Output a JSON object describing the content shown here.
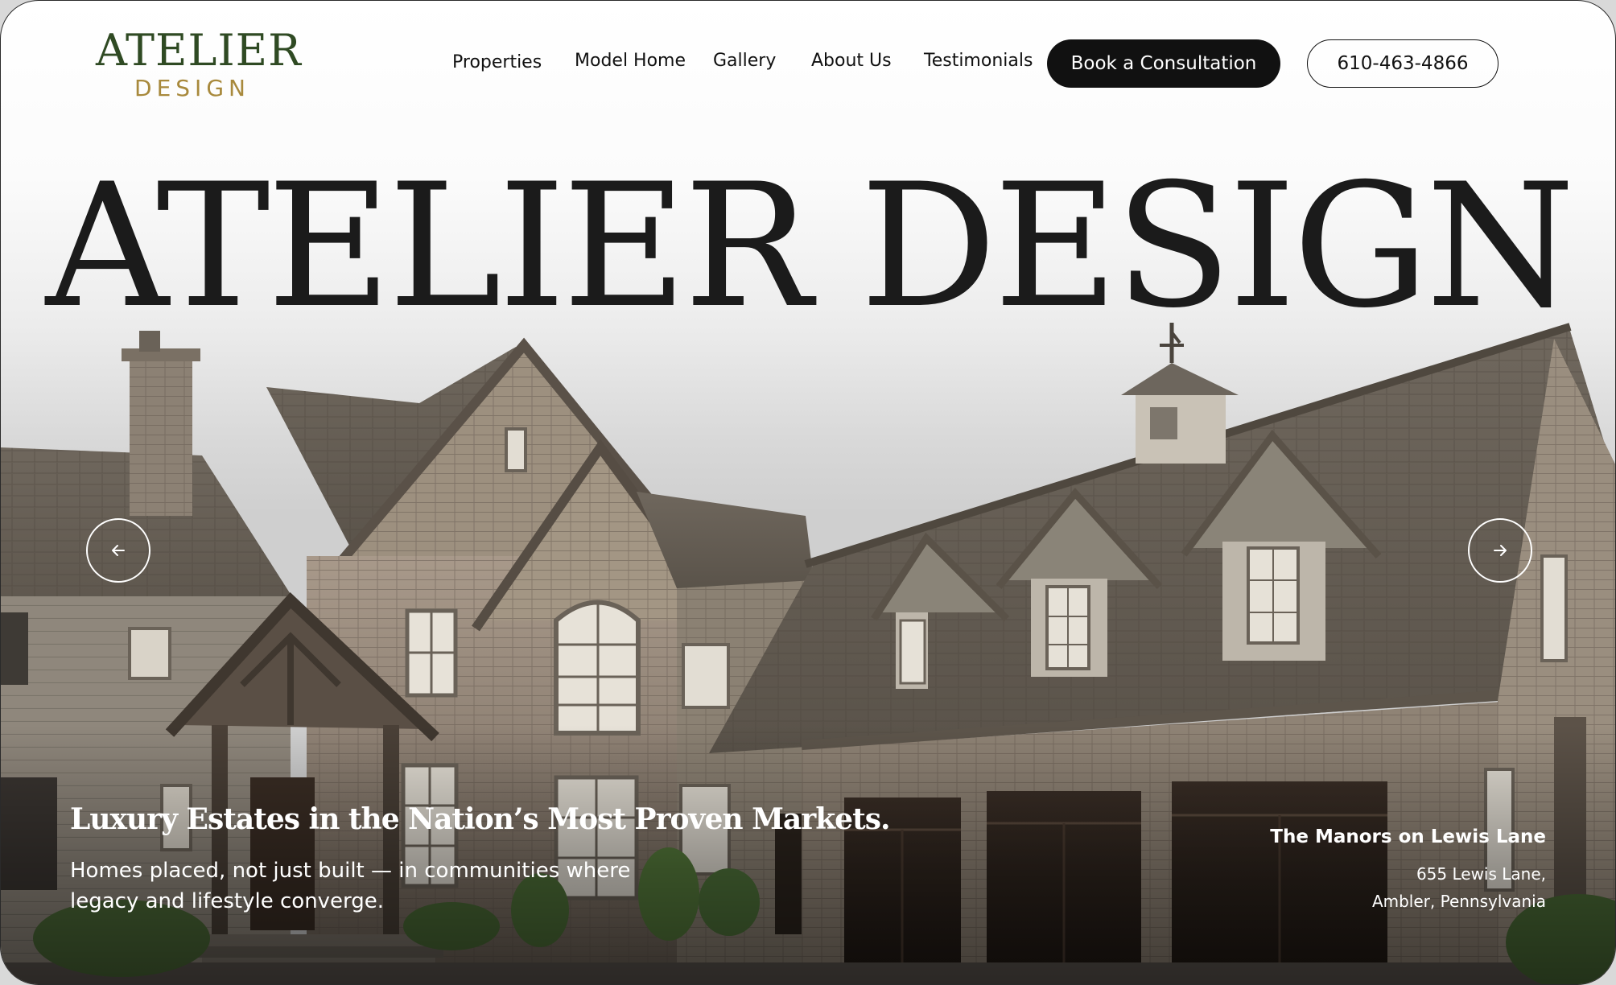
{
  "logo": {
    "top": "ATELIER",
    "bottom": "DESIGN"
  },
  "nav": {
    "items": [
      {
        "label": "Properties"
      },
      {
        "label": "Model Home"
      },
      {
        "label": "Gallery"
      },
      {
        "label": "About Us"
      },
      {
        "label": "Testimonials"
      }
    ],
    "cta_label": "Book a Consultation",
    "phone": "610-463-4866"
  },
  "hero": {
    "title": "ATELIER DESIGN",
    "tagline": "Luxury Estates in the Nation’s Most Proven Markets.",
    "subline": "Homes placed, not just built — in communities where legacy and lifestyle converge.",
    "property_name": "The Manors on Lewis Lane",
    "property_address_line1": "655 Lewis Lane,",
    "property_address_line2": "Ambler, Pennsylvania"
  },
  "icons": {
    "prev": "arrow-left-icon",
    "next": "arrow-right-icon"
  },
  "colors": {
    "logo_green": "#2f4a23",
    "logo_gold": "#a8893c",
    "text_dark": "#111111",
    "button_bg": "#111111"
  }
}
